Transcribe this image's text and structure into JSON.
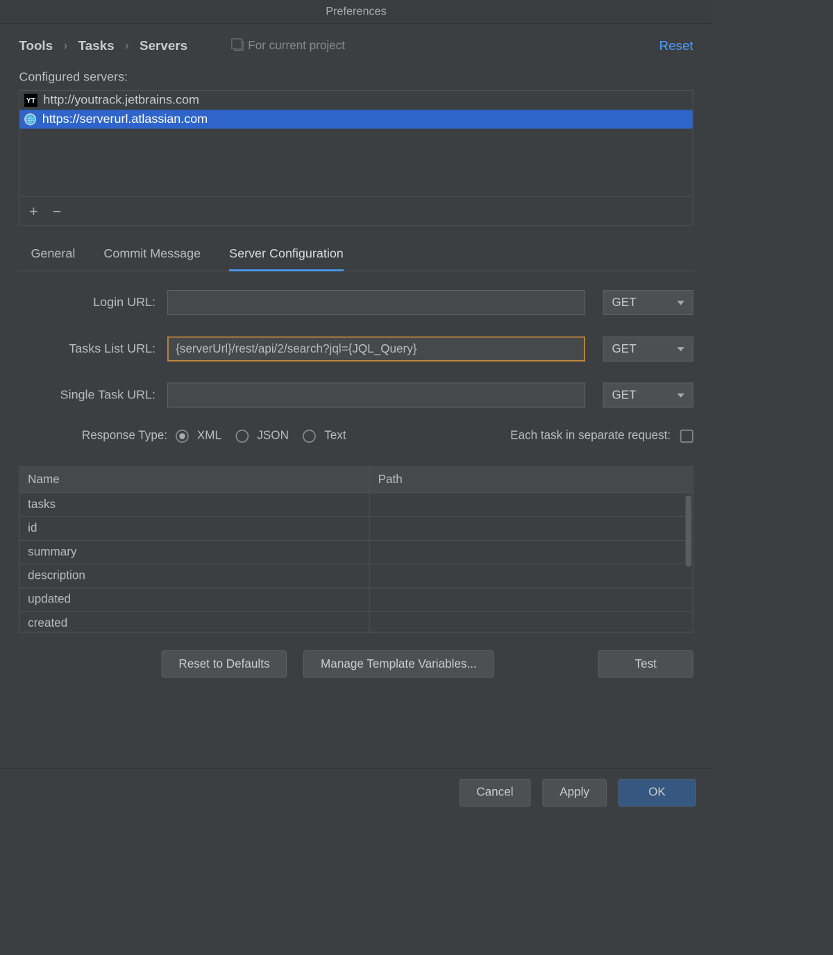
{
  "window_title": "Preferences",
  "breadcrumb": {
    "item0": "Tools",
    "item1": "Tasks",
    "item2": "Servers"
  },
  "for_current_project": "For current project",
  "reset": "Reset",
  "configured_servers_label": "Configured servers:",
  "servers": [
    {
      "icon": "YT",
      "url": "http://youtrack.jetbrains.com",
      "selected": false
    },
    {
      "icon": "globe",
      "url": "https://serverurl.atlassian.com",
      "selected": true
    }
  ],
  "tabs": {
    "general": "General",
    "commit": "Commit Message",
    "server_config": "Server Configuration"
  },
  "form": {
    "login_url_label": "Login URL:",
    "login_url_value": "",
    "tasks_list_label": "Tasks List URL:",
    "tasks_list_value": "{serverUrl}/rest/api/2/search?jql={JQL_Query}",
    "single_task_label": "Single Task URL:",
    "single_task_value": "",
    "method_get": "GET"
  },
  "response_type_label": "Response Type:",
  "response_types": {
    "xml": "XML",
    "json": "JSON",
    "text": "Text"
  },
  "each_task_label": "Each task in separate request:",
  "table": {
    "col_name": "Name",
    "col_path": "Path",
    "rows": [
      {
        "name": "tasks",
        "path": ""
      },
      {
        "name": "id",
        "path": ""
      },
      {
        "name": "summary",
        "path": ""
      },
      {
        "name": "description",
        "path": ""
      },
      {
        "name": "updated",
        "path": ""
      },
      {
        "name": "created",
        "path": ""
      }
    ]
  },
  "buttons": {
    "reset_defaults": "Reset to Defaults",
    "manage_vars": "Manage Template Variables...",
    "test": "Test",
    "cancel": "Cancel",
    "apply": "Apply",
    "ok": "OK"
  }
}
